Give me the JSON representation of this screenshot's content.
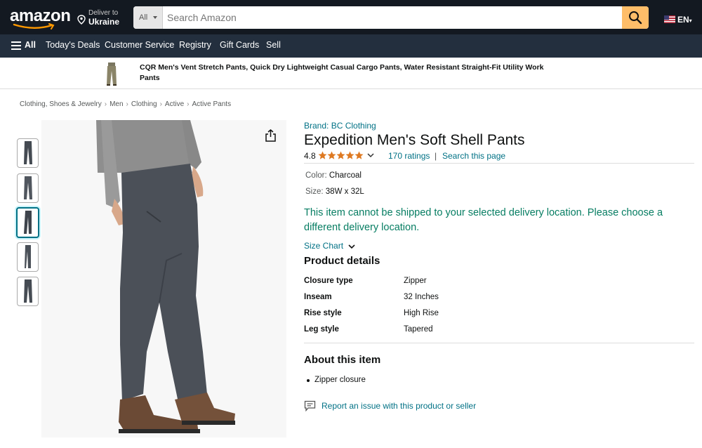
{
  "header": {
    "logo": "amazon",
    "deliver_line1": "Deliver to",
    "deliver_line2": "Ukraine",
    "search_category": "All",
    "search_placeholder": "Search Amazon",
    "language": "EN"
  },
  "subnav": {
    "all_label": "All",
    "items": [
      "Today's Deals",
      "Customer Service",
      "Registry",
      "Gift Cards",
      "Sell"
    ]
  },
  "sponsored": {
    "text": "CQR Men's Vent Stretch Pants, Quick Dry Lightweight Casual Cargo Pants, Water Resistant Straight-Fit Utility Work Pants"
  },
  "breadcrumb": [
    "Clothing, Shoes & Jewelry",
    "Men",
    "Clothing",
    "Active",
    "Active Pants"
  ],
  "product": {
    "brand": "Brand: BC Clothing",
    "title": "Expedition Men's Soft Shell Pants",
    "rating": "4.8",
    "rating_value": 4.8,
    "ratings_count": "170 ratings",
    "search_page": "Search this page",
    "color_label": "Color:",
    "color_value": "Charcoal",
    "size_label": "Size:",
    "size_value": "38W x 32L",
    "shipping_message": "This item cannot be shipped to your selected delivery location. Please choose a different delivery location.",
    "size_chart": "Size Chart",
    "details_heading": "Product details",
    "details": [
      {
        "key": "Closure type",
        "value": "Zipper"
      },
      {
        "key": "Inseam",
        "value": "32 Inches"
      },
      {
        "key": "Rise style",
        "value": "High Rise"
      },
      {
        "key": "Leg style",
        "value": "Tapered"
      }
    ],
    "about_heading": "About this item",
    "about_bullets": [
      "Zipper closure"
    ],
    "report_link": "Report an issue with this product or seller"
  },
  "colors": {
    "nav_dark": "#131921",
    "nav_sub": "#232f3e",
    "search_button": "#febd69",
    "link": "#007185",
    "success": "#067d62",
    "star": "#de7921"
  }
}
